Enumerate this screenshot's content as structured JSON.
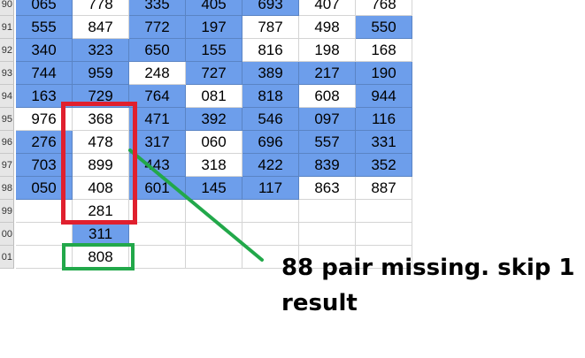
{
  "sheet": {
    "row_numbers": [
      "90",
      "91",
      "92",
      "93",
      "94",
      "95",
      "96",
      "97",
      "98",
      "99",
      "00",
      "01"
    ],
    "rows": [
      [
        {
          "v": "065",
          "c": "blue"
        },
        {
          "v": "778",
          "c": "white"
        },
        {
          "v": "335",
          "c": "blue"
        },
        {
          "v": "405",
          "c": "blue"
        },
        {
          "v": "693",
          "c": "blue"
        },
        {
          "v": "407",
          "c": "white"
        },
        {
          "v": "768",
          "c": "white"
        }
      ],
      [
        {
          "v": "555",
          "c": "blue"
        },
        {
          "v": "847",
          "c": "white"
        },
        {
          "v": "772",
          "c": "blue"
        },
        {
          "v": "197",
          "c": "blue"
        },
        {
          "v": "787",
          "c": "white"
        },
        {
          "v": "498",
          "c": "white"
        },
        {
          "v": "550",
          "c": "blue"
        }
      ],
      [
        {
          "v": "340",
          "c": "blue"
        },
        {
          "v": "323",
          "c": "blue"
        },
        {
          "v": "650",
          "c": "blue"
        },
        {
          "v": "155",
          "c": "blue"
        },
        {
          "v": "816",
          "c": "white"
        },
        {
          "v": "198",
          "c": "white"
        },
        {
          "v": "168",
          "c": "white"
        }
      ],
      [
        {
          "v": "744",
          "c": "blue"
        },
        {
          "v": "959",
          "c": "blue"
        },
        {
          "v": "248",
          "c": "white"
        },
        {
          "v": "727",
          "c": "blue"
        },
        {
          "v": "389",
          "c": "blue"
        },
        {
          "v": "217",
          "c": "blue"
        },
        {
          "v": "190",
          "c": "blue"
        }
      ],
      [
        {
          "v": "163",
          "c": "blue"
        },
        {
          "v": "729",
          "c": "blue"
        },
        {
          "v": "764",
          "c": "blue"
        },
        {
          "v": "081",
          "c": "white"
        },
        {
          "v": "818",
          "c": "blue"
        },
        {
          "v": "608",
          "c": "white"
        },
        {
          "v": "944",
          "c": "blue"
        }
      ],
      [
        {
          "v": "976",
          "c": "white"
        },
        {
          "v": "368",
          "c": "white"
        },
        {
          "v": "471",
          "c": "blue"
        },
        {
          "v": "392",
          "c": "blue"
        },
        {
          "v": "546",
          "c": "blue"
        },
        {
          "v": "097",
          "c": "blue"
        },
        {
          "v": "116",
          "c": "blue"
        }
      ],
      [
        {
          "v": "276",
          "c": "blue"
        },
        {
          "v": "478",
          "c": "white"
        },
        {
          "v": "317",
          "c": "blue"
        },
        {
          "v": "060",
          "c": "white"
        },
        {
          "v": "696",
          "c": "blue"
        },
        {
          "v": "557",
          "c": "blue"
        },
        {
          "v": "331",
          "c": "blue"
        }
      ],
      [
        {
          "v": "703",
          "c": "blue"
        },
        {
          "v": "899",
          "c": "white"
        },
        {
          "v": "443",
          "c": "blue"
        },
        {
          "v": "318",
          "c": "white"
        },
        {
          "v": "422",
          "c": "blue"
        },
        {
          "v": "839",
          "c": "blue"
        },
        {
          "v": "352",
          "c": "blue"
        }
      ],
      [
        {
          "v": "050",
          "c": "blue"
        },
        {
          "v": "408",
          "c": "white"
        },
        {
          "v": "601",
          "c": "blue"
        },
        {
          "v": "145",
          "c": "blue"
        },
        {
          "v": "117",
          "c": "blue"
        },
        {
          "v": "863",
          "c": "white"
        },
        {
          "v": "887",
          "c": "white"
        }
      ],
      [
        {
          "v": "",
          "c": "white"
        },
        {
          "v": "281",
          "c": "white"
        },
        {
          "v": "",
          "c": "white"
        },
        {
          "v": "",
          "c": "white"
        },
        {
          "v": "",
          "c": "white"
        },
        {
          "v": "",
          "c": "white"
        },
        {
          "v": "",
          "c": "white"
        }
      ],
      [
        {
          "v": "",
          "c": "white"
        },
        {
          "v": "311",
          "c": "blue"
        },
        {
          "v": "",
          "c": "white"
        },
        {
          "v": "",
          "c": "white"
        },
        {
          "v": "",
          "c": "white"
        },
        {
          "v": "",
          "c": "white"
        },
        {
          "v": "",
          "c": "white"
        }
      ],
      [
        {
          "v": "",
          "c": "white"
        },
        {
          "v": "808",
          "c": "white"
        },
        {
          "v": "",
          "c": "white"
        },
        {
          "v": "",
          "c": "white"
        },
        {
          "v": "",
          "c": "white"
        },
        {
          "v": "",
          "c": "white"
        },
        {
          "v": "",
          "c": "white"
        }
      ]
    ]
  },
  "colors": {
    "cell_blue": "#6d9eeb",
    "highlight_red": "#e0202e",
    "highlight_green": "#22a84a",
    "arrow_green": "#22a84a"
  },
  "annotation": {
    "line1": "88 pair missing. skip 1",
    "line2": "result"
  }
}
